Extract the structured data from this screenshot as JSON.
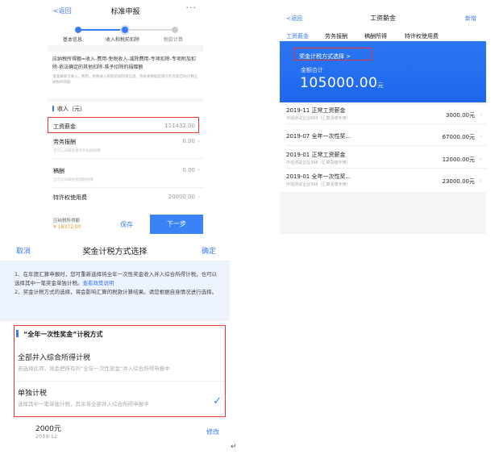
{
  "declaration": {
    "back_label": "返回",
    "title": "标准申报",
    "more_label": "···",
    "steps": [
      "基本信息",
      "收入和税前扣除",
      "税款计算"
    ],
    "formula_text": "应纳税所得额=收入-费用-免税收入-减除费用-专项扣除-专项附加扣除-依法确定的其他扣除-准予扣除的捐赠额",
    "formula_note": "请准确填写收入、费用、免税收入和税前扣除等信息，系统将根据您填写的内容自动计算应纳税所得额",
    "income_header": "收入（元）",
    "rows": [
      {
        "label": "工资薪金",
        "value": "111432.00",
        "hint": ""
      },
      {
        "label": "劳务报酬",
        "value": "0.00",
        "hint": "您可以详细查看劳务报酬明细"
      },
      {
        "label": "稿酬",
        "value": "0.00",
        "hint": "您可以详细查看稿酬明细"
      },
      {
        "label": "特许权使用费",
        "value": "20000.00",
        "hint": ""
      }
    ],
    "footer_label": "应纳税所得额",
    "footer_amount": "¥ 18372.00",
    "save_label": "保存",
    "next_label": "下一步"
  },
  "salary": {
    "back_label": "返回",
    "title": "工资薪金",
    "add_label": "新增",
    "tabs": [
      "工资薪金",
      "劳务报酬",
      "稿酬所得",
      "特许权使用费"
    ],
    "method_label": "奖金计税方式选择 >",
    "sum_label": "金额合计",
    "sum_value": "105000.00",
    "sum_unit": "元",
    "items": [
      {
        "title": "2019-11 正常工资薪金",
        "sub": "中强测试企业683（汇算清缴专用）",
        "amount": "3000.00元"
      },
      {
        "title": "2019-07 全年一次性奖...",
        "sub": "",
        "amount": "67000.00元"
      },
      {
        "title": "2019-01 正常工资薪金",
        "sub": "中强测试企业398（汇算清缴专用）",
        "amount": "12000.00元"
      },
      {
        "title": "2019-01 全年一次性奖...",
        "sub": "中强测试企业398（汇算清缴专用）",
        "amount": "23000.00元"
      }
    ]
  },
  "bonus": {
    "cancel_label": "取消",
    "title": "奖金计税方式选择",
    "ok_label": "确定",
    "notice_1": "1、在年度汇算申报时，您可重新选择将全年一次性奖金收入并入综合所得计税，也可以选择其中一笔奖金单独计税。",
    "notice_link": "查看政策说明",
    "notice_2": "2、奖金计税方式的选择，将会影响汇算的税款计算结果。请您根据自身情况进行选择。",
    "section_title": "“全年一次性奖金”计税方式",
    "options": [
      {
        "title": "全部并入综合所得计税",
        "desc": "若选择此项，将会把所有的“全年一次性奖金”并入综合所得申报中"
      },
      {
        "title": "单独计税",
        "desc": "选择其中一笔单独计税，其余将全部并入综合所得申报中"
      }
    ],
    "amount": "2000元",
    "date": "2019-12",
    "modify_label": "修改"
  },
  "colors": {
    "accent": "#3b7bf5",
    "highlight": "#e33333",
    "warning": "#e8912d"
  }
}
